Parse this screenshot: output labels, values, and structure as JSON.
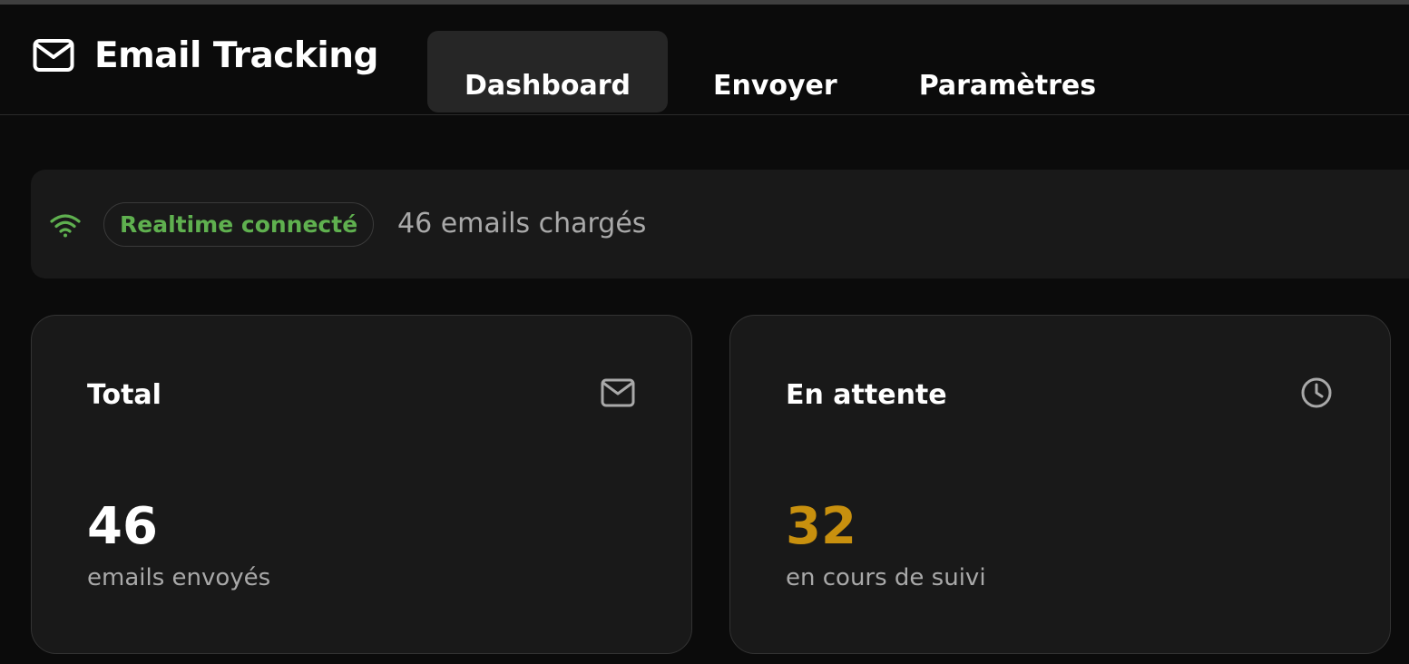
{
  "header": {
    "title": "Email Tracking",
    "icon": "mail-icon",
    "tabs": [
      {
        "label": "Dashboard",
        "active": true
      },
      {
        "label": "Envoyer",
        "active": false
      },
      {
        "label": "Paramètres",
        "active": false
      }
    ]
  },
  "status": {
    "icon": "wifi-icon",
    "badge": "Realtime connecté",
    "badge_color": "#5fb04f",
    "loaded_text": "46 emails chargés"
  },
  "cards": [
    {
      "title": "Total",
      "icon": "mail-icon",
      "value": "46",
      "value_color": "#ffffff",
      "subtitle": "emails envoyés"
    },
    {
      "title": "En attente",
      "icon": "clock-icon",
      "value": "32",
      "value_color": "#c8900e",
      "subtitle": "en cours de suivi"
    }
  ]
}
